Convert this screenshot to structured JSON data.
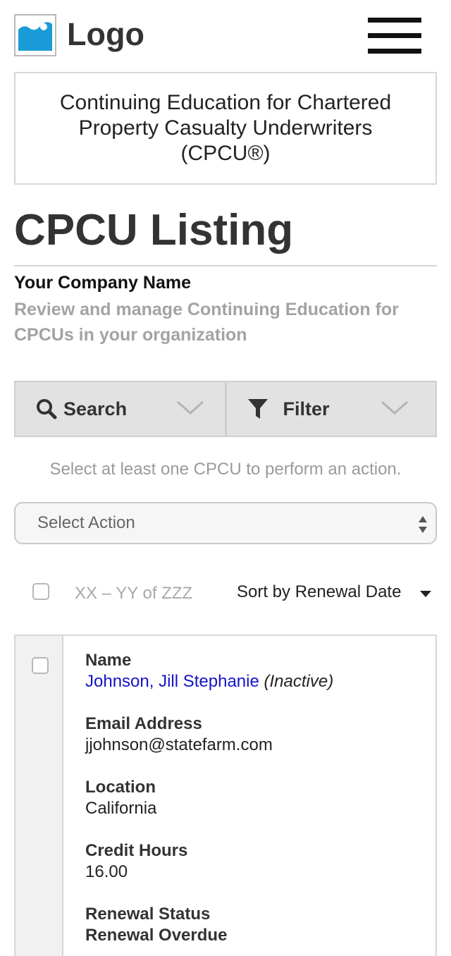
{
  "header": {
    "logo_text": "Logo",
    "logo_icon": "image-icon",
    "menu_icon": "hamburger-menu-icon"
  },
  "program": {
    "title": "Continuing Education for Chartered Property Casualty Underwriters (CPCU®)"
  },
  "page": {
    "title": "CPCU Listing",
    "company": "Your Company Name",
    "description": "Review and manage Continuing Education for CPCUs in your organization"
  },
  "toolbar": {
    "search_label": "Search",
    "search_icon": "search-icon",
    "filter_label": "Filter",
    "filter_icon": "filter-icon"
  },
  "actions": {
    "hint": "Select at least one CPCU to perform an action.",
    "select_value": "Select Action"
  },
  "list": {
    "range_text": "XX – YY of ZZZ",
    "sort_label": "Sort by Renewal Date"
  },
  "record": {
    "name_label": "Name",
    "name_value": "Johnson, Jill Stephanie",
    "name_status": "(Inactive)",
    "email_label": "Email Address",
    "email_value": "jjohnson@statefarm.com",
    "location_label": "Location",
    "location_value": "California",
    "credit_label": "Credit Hours",
    "credit_value": "16.00",
    "renewal_label": "Renewal Status",
    "renewal_value": "Renewal Overdue"
  },
  "colors": {
    "link": "#1414c8",
    "toolbar_bg": "#e2e2e2",
    "muted_text": "#a3a3a3",
    "logo_sky": "#1a9bd7"
  }
}
